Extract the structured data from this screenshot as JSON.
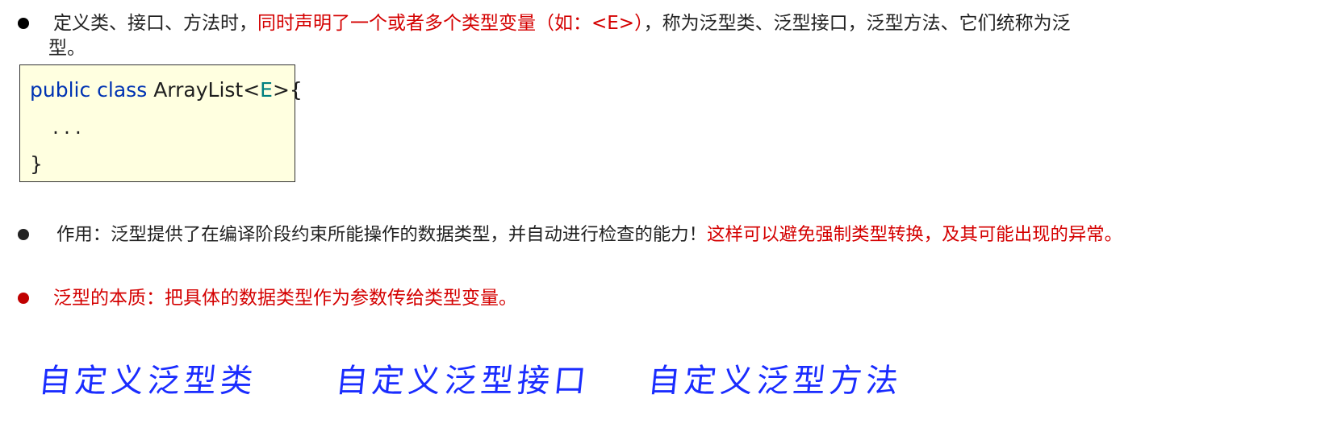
{
  "bullet1": {
    "text_a": "定义类、接口、方法时，",
    "text_red": "同时声明了一个或者多个类型变量（如：<E>）",
    "text_b": "，称为泛型类、泛型接口，泛型方法、它们统称为泛",
    "text_wrap": "型。"
  },
  "code": {
    "keyword": "public class",
    "class_name": "ArrayList<",
    "type_param": "E",
    "open_close": ">{",
    "ellipsis": "...",
    "close_brace": "}"
  },
  "bullet2": {
    "text_a": "作用：泛型提供了在编译阶段约束所能操作的数据类型，并自动进行检查的能力！",
    "text_red": "这样可以避免强制类型转换，及其可能出现的异常。"
  },
  "bullet3": {
    "text": "泛型的本质：把具体的数据类型作为参数传给类型变量。"
  },
  "handwritten": {
    "item1": "自定义泛型类",
    "item2": "自定义泛型接口",
    "item3": "自定义泛型方法"
  },
  "colors": {
    "red": "#d40000",
    "keyword_blue": "#0033b3",
    "type_param_teal": "#008080",
    "code_bg": "#ffffe0",
    "handwriting_blue": "#1a2cff"
  }
}
